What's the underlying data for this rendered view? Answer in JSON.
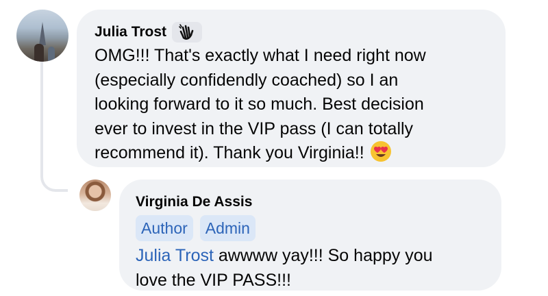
{
  "comment": {
    "author": "Julia Trost",
    "author_badge_icon": "waving-hand-icon",
    "text": "OMG!!! That's exactly what I need right now\n(especially confidendly coached) so I an\nlooking forward to it so much. Best decision\never to invest in the VIP pass (I can totally\nrecommend it). Thank you Virginia!!",
    "emoji": "heart-eyes-emoji"
  },
  "reply": {
    "author": "Virginia De Assis",
    "roles": [
      "Author",
      "Admin"
    ],
    "mention": "Julia Trost",
    "text_line1": " awwww yay!!! So happy you",
    "text_line2": "love the VIP PASS!!!"
  },
  "colors": {
    "bubble_bg": "#f0f2f5",
    "link_blue": "#2c64b8",
    "tag_bg": "#dbe7f7",
    "text": "#050505"
  }
}
